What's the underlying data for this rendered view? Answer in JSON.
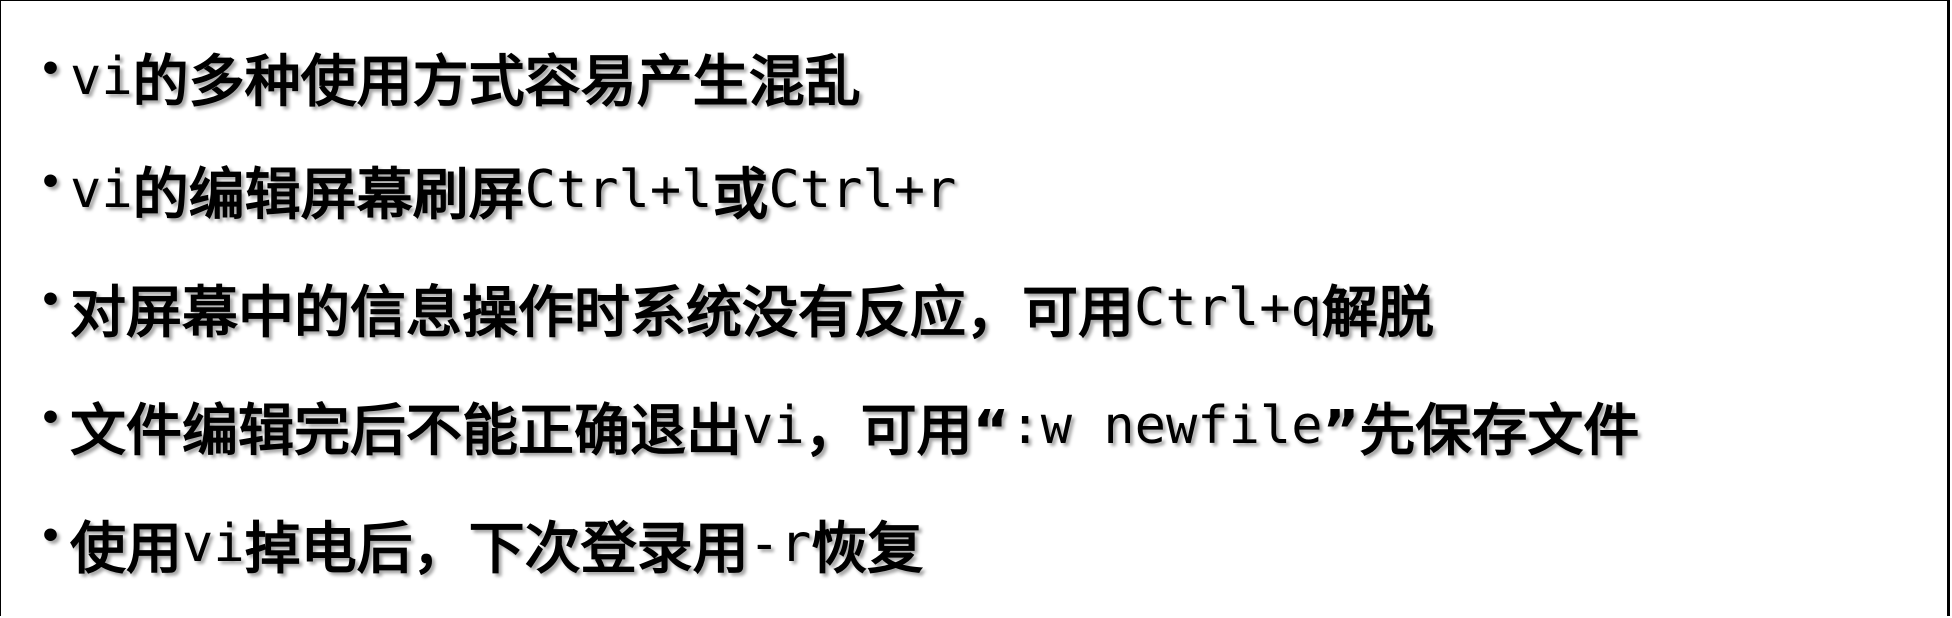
{
  "slide": {
    "bullet_char": "•",
    "items": [
      {
        "segments": [
          {
            "type": "mono",
            "text": "vi"
          },
          {
            "type": "cjk",
            "text": "的多种使用方式容易产生混乱"
          }
        ]
      },
      {
        "segments": [
          {
            "type": "mono",
            "text": "vi"
          },
          {
            "type": "cjk",
            "text": "的编辑屏幕刷屏"
          },
          {
            "type": "mono",
            "text": "Ctrl+l"
          },
          {
            "type": "cjk",
            "text": "或"
          },
          {
            "type": "mono",
            "text": "Ctrl+r"
          }
        ]
      },
      {
        "segments": [
          {
            "type": "cjk",
            "text": "对屏幕中的信息操作时系统没有反应，可用"
          },
          {
            "type": "mono",
            "text": "Ctrl+q"
          },
          {
            "type": "cjk",
            "text": "解脱"
          }
        ]
      },
      {
        "segments": [
          {
            "type": "cjk",
            "text": "文件编辑完后不能正确退出"
          },
          {
            "type": "mono",
            "text": "vi"
          },
          {
            "type": "cjk",
            "text": "，可用“"
          },
          {
            "type": "mono",
            "text": ":w newfile"
          },
          {
            "type": "cjk",
            "text": "”先保存文件"
          }
        ]
      },
      {
        "segments": [
          {
            "type": "cjk",
            "text": "使用"
          },
          {
            "type": "mono",
            "text": "vi"
          },
          {
            "type": "cjk",
            "text": "掉电后，下次登录用"
          },
          {
            "type": "mono",
            "text": "-r"
          },
          {
            "type": "cjk",
            "text": "恢复"
          }
        ]
      }
    ]
  }
}
